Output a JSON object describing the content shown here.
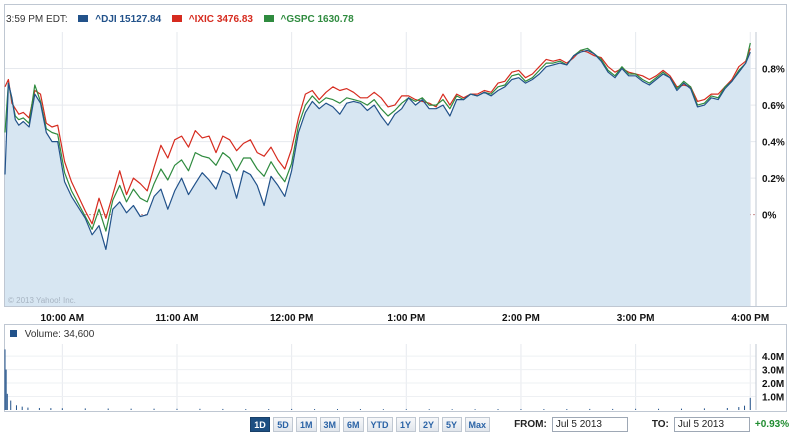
{
  "header": {
    "time": "3:59 PM EDT:",
    "legend": [
      {
        "symbol": "^DJI",
        "value": "15127.84",
        "color": "#22528a"
      },
      {
        "symbol": "^IXIC",
        "value": "3476.83",
        "color": "#d62b1f"
      },
      {
        "symbol": "^GSPC",
        "value": "1630.78",
        "color": "#2f8b3f"
      }
    ]
  },
  "chart_data": {
    "type": "line",
    "x_tick_labels": [
      "10:00 AM",
      "11:00 AM",
      "12:00 PM",
      "1:00 PM",
      "2:00 PM",
      "3:00 PM",
      "4:00 PM"
    ],
    "x_tick_hours": [
      10,
      11,
      12,
      13,
      14,
      15,
      16
    ],
    "xlim": [
      9.5,
      16.05
    ],
    "ylim": [
      -0.005,
      0.01
    ],
    "y_ticks": [
      0,
      0.002,
      0.004,
      0.006,
      0.008
    ],
    "y_tick_labels": [
      "0%",
      "0.2%",
      "0.4%",
      "0.6%",
      "0.8%"
    ],
    "series": [
      {
        "name": "^DJI",
        "color": "#22528a",
        "fill": "#d7e6f2",
        "x": [
          9.5,
          9.53,
          9.56,
          9.59,
          9.62,
          9.66,
          9.71,
          9.76,
          9.81,
          9.86,
          9.91,
          9.96,
          10.02,
          10.08,
          10.14,
          10.2,
          10.26,
          10.32,
          10.38,
          10.44,
          10.5,
          10.56,
          10.62,
          10.68,
          10.74,
          10.8,
          10.86,
          10.92,
          10.98,
          11.04,
          11.1,
          11.16,
          11.22,
          11.28,
          11.34,
          11.4,
          11.46,
          11.52,
          11.58,
          11.64,
          11.7,
          11.76,
          11.82,
          11.88,
          11.94,
          12.0,
          12.06,
          12.12,
          12.18,
          12.24,
          12.3,
          12.36,
          12.42,
          12.48,
          12.54,
          12.6,
          12.66,
          12.72,
          12.78,
          12.84,
          12.9,
          12.96,
          13.02,
          13.08,
          13.14,
          13.2,
          13.26,
          13.32,
          13.38,
          13.44,
          13.5,
          13.56,
          13.62,
          13.68,
          13.74,
          13.8,
          13.86,
          13.92,
          13.98,
          14.04,
          14.1,
          14.16,
          14.22,
          14.28,
          14.34,
          14.4,
          14.46,
          14.52,
          14.58,
          14.64,
          14.7,
          14.76,
          14.82,
          14.88,
          14.94,
          15.0,
          15.06,
          15.12,
          15.18,
          15.24,
          15.3,
          15.36,
          15.42,
          15.48,
          15.54,
          15.6,
          15.66,
          15.72,
          15.78,
          15.84,
          15.9,
          15.96,
          16.0
        ],
        "values": [
          0.0022,
          0.0072,
          0.0064,
          0.0052,
          0.0049,
          0.0051,
          0.0048,
          0.0066,
          0.0061,
          0.0045,
          0.004,
          0.004,
          0.0018,
          0.001,
          0.0004,
          -0.0002,
          -0.0011,
          -0.0006,
          -0.0019,
          0.0003,
          0.0007,
          0.0001,
          0.0005,
          -0.0001,
          0.0,
          0.001,
          0.0014,
          0.0003,
          0.0013,
          0.002,
          0.0011,
          0.0017,
          0.0023,
          0.0019,
          0.0014,
          0.0024,
          0.0022,
          0.0009,
          0.0024,
          0.0022,
          0.0016,
          0.0005,
          0.0021,
          0.0016,
          0.001,
          0.0024,
          0.0045,
          0.0056,
          0.0062,
          0.0058,
          0.0061,
          0.0059,
          0.0055,
          0.0061,
          0.0062,
          0.0061,
          0.0057,
          0.006,
          0.0054,
          0.0049,
          0.0055,
          0.0058,
          0.0064,
          0.006,
          0.0063,
          0.0058,
          0.0058,
          0.006,
          0.0054,
          0.0063,
          0.0063,
          0.0066,
          0.0065,
          0.0067,
          0.0065,
          0.0068,
          0.007,
          0.0074,
          0.0075,
          0.0072,
          0.0074,
          0.0077,
          0.0081,
          0.0082,
          0.0083,
          0.0082,
          0.0087,
          0.0089,
          0.009,
          0.0088,
          0.0084,
          0.0078,
          0.0075,
          0.008,
          0.0076,
          0.0076,
          0.0073,
          0.0071,
          0.0074,
          0.0077,
          0.0075,
          0.0068,
          0.0072,
          0.0069,
          0.0059,
          0.006,
          0.0064,
          0.0063,
          0.0069,
          0.0073,
          0.0078,
          0.0083,
          0.0089
        ]
      },
      {
        "name": "^IXIC",
        "color": "#d62b1f",
        "x": [
          9.5,
          9.53,
          9.56,
          9.59,
          9.62,
          9.66,
          9.71,
          9.76,
          9.81,
          9.86,
          9.91,
          9.96,
          10.02,
          10.08,
          10.14,
          10.2,
          10.26,
          10.32,
          10.38,
          10.44,
          10.5,
          10.56,
          10.62,
          10.68,
          10.74,
          10.8,
          10.86,
          10.92,
          10.98,
          11.04,
          11.1,
          11.16,
          11.22,
          11.28,
          11.34,
          11.4,
          11.46,
          11.52,
          11.58,
          11.64,
          11.7,
          11.76,
          11.82,
          11.88,
          11.94,
          12.0,
          12.06,
          12.12,
          12.18,
          12.24,
          12.3,
          12.36,
          12.42,
          12.48,
          12.54,
          12.6,
          12.66,
          12.72,
          12.78,
          12.84,
          12.9,
          12.96,
          13.02,
          13.08,
          13.14,
          13.2,
          13.26,
          13.32,
          13.38,
          13.44,
          13.5,
          13.56,
          13.62,
          13.68,
          13.74,
          13.8,
          13.86,
          13.92,
          13.98,
          14.04,
          14.1,
          14.16,
          14.22,
          14.28,
          14.34,
          14.4,
          14.46,
          14.52,
          14.58,
          14.64,
          14.7,
          14.76,
          14.82,
          14.88,
          14.94,
          15.0,
          15.06,
          15.12,
          15.18,
          15.24,
          15.3,
          15.36,
          15.42,
          15.48,
          15.54,
          15.6,
          15.66,
          15.72,
          15.78,
          15.84,
          15.9,
          15.96,
          16.0
        ],
        "values": [
          0.007,
          0.0074,
          0.0061,
          0.0058,
          0.0055,
          0.0056,
          0.0053,
          0.0068,
          0.0066,
          0.005,
          0.0048,
          0.0049,
          0.0029,
          0.0018,
          0.001,
          0.0002,
          -0.0005,
          0.0009,
          -0.0002,
          0.0011,
          0.0024,
          0.0011,
          0.002,
          0.0017,
          0.0013,
          0.0026,
          0.0038,
          0.0031,
          0.0041,
          0.0043,
          0.0037,
          0.0046,
          0.0042,
          0.0043,
          0.0034,
          0.0043,
          0.0041,
          0.0035,
          0.0039,
          0.0041,
          0.0034,
          0.0032,
          0.0037,
          0.003,
          0.0025,
          0.0036,
          0.0053,
          0.0066,
          0.0068,
          0.0063,
          0.0067,
          0.007,
          0.0068,
          0.0069,
          0.0067,
          0.0064,
          0.0064,
          0.0067,
          0.0064,
          0.0059,
          0.006,
          0.0065,
          0.0065,
          0.0063,
          0.0062,
          0.0061,
          0.0059,
          0.0066,
          0.006,
          0.0066,
          0.0064,
          0.0066,
          0.0066,
          0.0068,
          0.0067,
          0.0072,
          0.0073,
          0.0078,
          0.0079,
          0.0075,
          0.0077,
          0.0081,
          0.0085,
          0.0084,
          0.0085,
          0.0083,
          0.0086,
          0.009,
          0.0089,
          0.0087,
          0.0086,
          0.0081,
          0.0078,
          0.008,
          0.0078,
          0.0077,
          0.0076,
          0.0074,
          0.0076,
          0.0079,
          0.0076,
          0.007,
          0.0071,
          0.007,
          0.0062,
          0.0063,
          0.0066,
          0.0066,
          0.007,
          0.0074,
          0.0081,
          0.0084,
          0.0091
        ]
      },
      {
        "name": "^GSPC",
        "color": "#2f8b3f",
        "x": [
          9.5,
          9.53,
          9.56,
          9.59,
          9.62,
          9.66,
          9.71,
          9.76,
          9.81,
          9.86,
          9.91,
          9.96,
          10.02,
          10.08,
          10.14,
          10.2,
          10.26,
          10.32,
          10.38,
          10.44,
          10.5,
          10.56,
          10.62,
          10.68,
          10.74,
          10.8,
          10.86,
          10.92,
          10.98,
          11.04,
          11.1,
          11.16,
          11.22,
          11.28,
          11.34,
          11.4,
          11.46,
          11.52,
          11.58,
          11.64,
          11.7,
          11.76,
          11.82,
          11.88,
          11.94,
          12.0,
          12.06,
          12.12,
          12.18,
          12.24,
          12.3,
          12.36,
          12.42,
          12.48,
          12.54,
          12.6,
          12.66,
          12.72,
          12.78,
          12.84,
          12.9,
          12.96,
          13.02,
          13.08,
          13.14,
          13.2,
          13.26,
          13.32,
          13.38,
          13.44,
          13.5,
          13.56,
          13.62,
          13.68,
          13.74,
          13.8,
          13.86,
          13.92,
          13.98,
          14.04,
          14.1,
          14.16,
          14.22,
          14.28,
          14.34,
          14.4,
          14.46,
          14.52,
          14.58,
          14.64,
          14.7,
          14.76,
          14.82,
          14.88,
          14.94,
          15.0,
          15.06,
          15.12,
          15.18,
          15.24,
          15.3,
          15.36,
          15.42,
          15.48,
          15.54,
          15.6,
          15.66,
          15.72,
          15.78,
          15.84,
          15.9,
          15.96,
          16.0
        ],
        "values": [
          0.0045,
          0.0072,
          0.0063,
          0.0054,
          0.0052,
          0.0053,
          0.005,
          0.0071,
          0.0062,
          0.0047,
          0.0045,
          0.0044,
          0.0023,
          0.0013,
          0.0006,
          -0.0001,
          -0.0008,
          0.0003,
          -0.0009,
          0.0008,
          0.0016,
          0.0007,
          0.0014,
          0.0009,
          0.0007,
          0.0017,
          0.0025,
          0.0019,
          0.0027,
          0.003,
          0.0024,
          0.0034,
          0.0032,
          0.0031,
          0.0027,
          0.0034,
          0.0031,
          0.0024,
          0.0031,
          0.0031,
          0.0025,
          0.0021,
          0.0029,
          0.0023,
          0.0018,
          0.0028,
          0.0049,
          0.006,
          0.0065,
          0.0061,
          0.0064,
          0.0063,
          0.0061,
          0.0064,
          0.0063,
          0.0062,
          0.006,
          0.0063,
          0.0058,
          0.0054,
          0.0057,
          0.0061,
          0.0064,
          0.0062,
          0.0064,
          0.006,
          0.006,
          0.0063,
          0.0058,
          0.0065,
          0.0063,
          0.0066,
          0.0065,
          0.0067,
          0.0066,
          0.007,
          0.0071,
          0.0076,
          0.0077,
          0.0073,
          0.0075,
          0.0079,
          0.0083,
          0.0083,
          0.0084,
          0.0082,
          0.0087,
          0.009,
          0.0091,
          0.0088,
          0.0085,
          0.0079,
          0.0076,
          0.0081,
          0.0077,
          0.0077,
          0.0074,
          0.0072,
          0.0075,
          0.0078,
          0.0075,
          0.0069,
          0.0073,
          0.007,
          0.006,
          0.0061,
          0.0065,
          0.0064,
          0.007,
          0.0073,
          0.0079,
          0.0083,
          0.0094
        ]
      }
    ],
    "volume": {
      "label": "Volume:",
      "value": "34,600",
      "color": "#22528a",
      "y_tick_labels": [
        "1.0M",
        "2.0M",
        "3.0M",
        "4.0M"
      ],
      "y_ticks": [
        1000000,
        2000000,
        3000000,
        4000000
      ],
      "ylim": [
        0,
        4900000
      ],
      "x": [
        9.5,
        9.51,
        9.52,
        9.55,
        9.6,
        9.65,
        9.7,
        9.8,
        9.9,
        10.0,
        10.2,
        10.4,
        10.6,
        10.8,
        11.0,
        11.2,
        11.4,
        11.6,
        11.8,
        12.0,
        12.2,
        12.4,
        12.6,
        12.8,
        13.0,
        13.2,
        13.4,
        13.6,
        13.8,
        14.0,
        14.2,
        14.4,
        14.6,
        14.8,
        15.0,
        15.2,
        15.4,
        15.6,
        15.8,
        15.9,
        15.95,
        16.0
      ],
      "values": [
        4500000,
        3000000,
        1200000,
        700000,
        350000,
        250000,
        180000,
        150000,
        140000,
        130000,
        120000,
        110000,
        100000,
        100000,
        90000,
        90000,
        80000,
        70000,
        70000,
        80000,
        70000,
        70000,
        70000,
        60000,
        60000,
        60000,
        60000,
        60000,
        70000,
        70000,
        70000,
        70000,
        80000,
        80000,
        90000,
        90000,
        100000,
        120000,
        150000,
        220000,
        320000,
        900000
      ]
    }
  },
  "copyright": "© 2013 Yahoo! Inc.",
  "controls": {
    "ranges": [
      "1D",
      "5D",
      "1M",
      "3M",
      "6M",
      "YTD",
      "1Y",
      "2Y",
      "5Y",
      "Max"
    ],
    "active_range": "1D",
    "from_label": "FROM:",
    "from_value": "Jul 5 2013",
    "to_label": "TO:",
    "to_value": "Jul 5 2013",
    "change": "+0.93%"
  }
}
